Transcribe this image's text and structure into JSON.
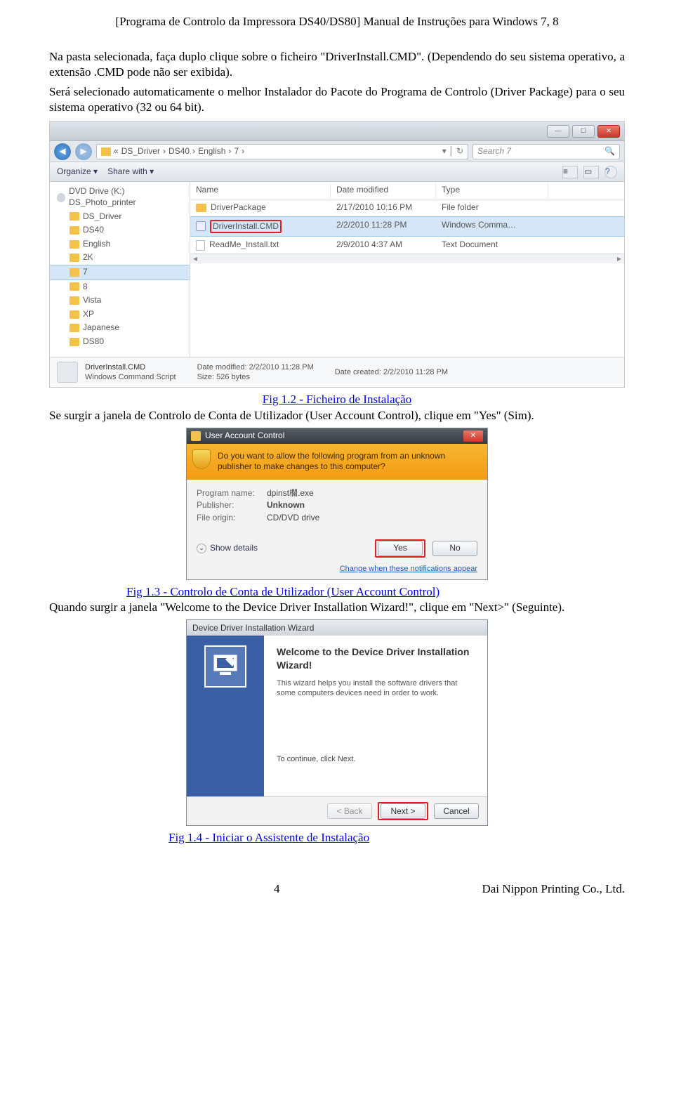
{
  "header": "[Programa de Controlo da Impressora DS40/DS80] Manual de Instruções para Windows 7, 8",
  "intro_p1": "Na pasta selecionada, faça duplo clique sobre o ficheiro \"DriverInstall.CMD\". (Dependendo do seu sistema operativo, a extensão .CMD pode não ser exibida).",
  "intro_p2": "Será selecionado automaticamente o melhor Instalador do Pacote do Programa de Controlo (Driver Package) para o seu sistema operativo (32 ou 64 bit).",
  "explorer": {
    "breadcrumb_bits": [
      "«",
      "DS_Driver",
      "›",
      "DS40",
      "›",
      "English",
      "›",
      "7",
      "›"
    ],
    "search_placeholder": "Search 7",
    "toolbar": {
      "organize": "Organize ▾",
      "share": "Share with ▾"
    },
    "tree": [
      {
        "label": "DVD Drive (K:) DS_Photo_printer",
        "level": "l1",
        "icon": "disc"
      },
      {
        "label": "DS_Driver",
        "level": "l2",
        "icon": "ficon"
      },
      {
        "label": "DS40",
        "level": "l2",
        "icon": "ficon"
      },
      {
        "label": "English",
        "level": "l2",
        "icon": "ficon"
      },
      {
        "label": "2K",
        "level": "l2",
        "icon": "ficon"
      },
      {
        "label": "7",
        "level": "l2",
        "icon": "ficon",
        "sel": true
      },
      {
        "label": "8",
        "level": "l2",
        "icon": "ficon"
      },
      {
        "label": "Vista",
        "level": "l2",
        "icon": "ficon"
      },
      {
        "label": "XP",
        "level": "l2",
        "icon": "ficon"
      },
      {
        "label": "Japanese",
        "level": "l2",
        "icon": "ficon"
      },
      {
        "label": "DS80",
        "level": "l2",
        "icon": "ficon"
      }
    ],
    "cols": {
      "name": "Name",
      "date": "Date modified",
      "type": "Type"
    },
    "rows": [
      {
        "name": "DriverPackage",
        "date": "2/17/2010 10:16 PM",
        "type": "File folder",
        "icon": "fi-folder"
      },
      {
        "name": "DriverInstall.CMD",
        "date": "2/2/2010 11:28 PM",
        "type": "Windows Comma…",
        "icon": "fi-cmd",
        "red": true,
        "sel": true
      },
      {
        "name": "ReadMe_Install.txt",
        "date": "2/9/2010 4:37 AM",
        "type": "Text Document",
        "icon": "fi-txt"
      }
    ],
    "details": {
      "name": "DriverInstall.CMD",
      "sub": "Windows Command Script",
      "dm_label": "Date modified:",
      "dm": "2/2/2010 11:28 PM",
      "sz_label": "Size:",
      "sz": "526 bytes",
      "dc_label": "Date created:",
      "dc": "2/2/2010 11:28 PM"
    }
  },
  "caption1": "Fig 1.2 - Ficheiro de Instalação",
  "after1": "Se surgir a janela de Controlo de Conta de Utilizador (User Account Control), clique em \"Yes\" (Sim).",
  "uac": {
    "title": "User Account Control",
    "question": "Do you want to allow the following program from an unknown publisher to make changes to this computer?",
    "pn_l": "Program name:",
    "pn": "dpinst欄.exe",
    "pub_l": "Publisher:",
    "pub": "Unknown",
    "fo_l": "File origin:",
    "fo": "CD/DVD drive",
    "show": "Show details",
    "yes": "Yes",
    "no": "No",
    "link": "Change when these notifications appear"
  },
  "caption2": "Fig 1.3 - Controlo de Conta de Utilizador (User Account Control)",
  "after2a": "Quando surgir a janela \"Welcome to the Device Driver Installation Wizard!\", clique em \"Next>\" (Seguinte).",
  "wizard": {
    "title": "Device Driver Installation Wizard",
    "heading": "Welcome to the Device Driver Installation Wizard!",
    "desc": "This wizard helps you install the software drivers that some computers devices need in order to work.",
    "cont": "To continue, click Next.",
    "back": "< Back",
    "next": "Next >",
    "cancel": "Cancel"
  },
  "caption3": "Fig 1.4 - Iniciar o Assistente de Instalação",
  "footer": {
    "page": "4",
    "company": "Dai Nippon Printing Co., Ltd."
  }
}
